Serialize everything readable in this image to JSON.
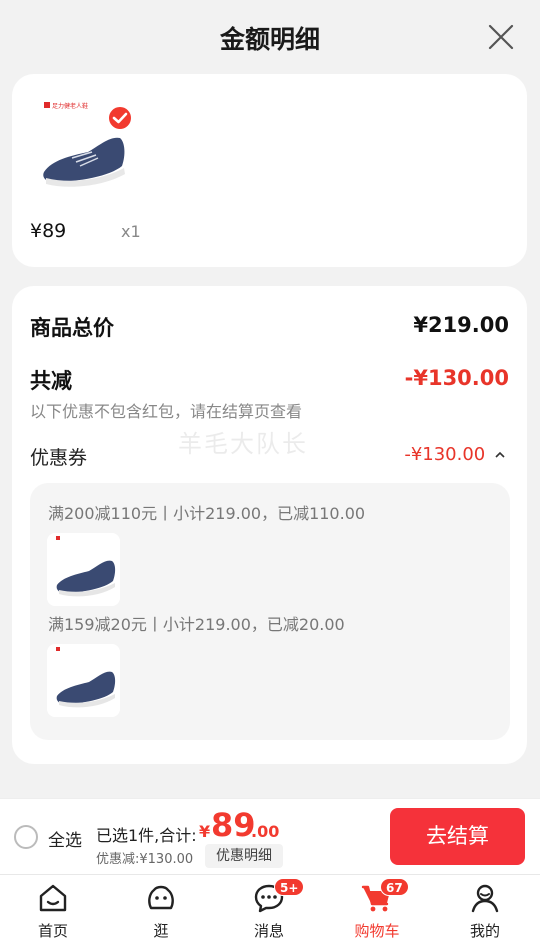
{
  "header": {
    "title": "金额明细"
  },
  "product": {
    "price": "¥89",
    "qty": "x1",
    "brand_text": "足力健老人鞋"
  },
  "summary": {
    "total_label": "商品总价",
    "total_value": "¥219.00",
    "reduce_label": "共减",
    "reduce_value": "-¥130.00",
    "reduce_note": "以下优惠不包含红包，请在结算页查看",
    "coupon_label": "优惠券",
    "coupon_value": "-¥130.00",
    "watermark": "羊毛大队长",
    "coupon_rules": [
      "满200减110元丨小计219.00，已减110.00",
      "满159减20元丨小计219.00，已减20.00"
    ]
  },
  "bottom_bar": {
    "select_all": "全选",
    "selected_text": "已选1件,合计:",
    "currency": "¥",
    "total_int": "89",
    "total_dec": ".00",
    "discount_text": "优惠减:¥130.00",
    "detail_label": "优惠明细",
    "checkout_label": "去结算"
  },
  "tabs": [
    {
      "label": "首页",
      "icon": "home-icon"
    },
    {
      "label": "逛",
      "icon": "browse-icon"
    },
    {
      "label": "消息",
      "icon": "message-icon",
      "badge": "5+"
    },
    {
      "label": "购物车",
      "icon": "cart-icon",
      "badge": "67",
      "active": true
    },
    {
      "label": "我的",
      "icon": "profile-icon"
    }
  ],
  "colors": {
    "accent": "#f23a2f",
    "background": "#f2f2f2"
  }
}
